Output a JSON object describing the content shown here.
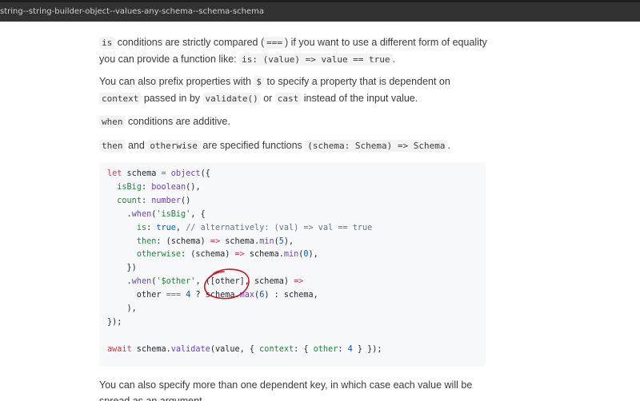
{
  "topbar": {
    "url_text": "string--string-builder-object--values-any-schema--schema-schema"
  },
  "paragraphs": {
    "p1": {
      "code1": "is",
      "text1": " conditions are strictly compared (",
      "code2": "===",
      "text2": ") if you want to use a different form of equality you can provide a function like: ",
      "code3": "is: (value) => value == true",
      "text3": "."
    },
    "p2": {
      "text1": "You can also prefix properties with ",
      "code1": "$",
      "text2": " to specify a property that is dependent on ",
      "code2": "context",
      "text3": " passed in by ",
      "code3": "validate()",
      "text4": " or ",
      "code4": "cast",
      "text5": " instead of the input value."
    },
    "p3": {
      "code1": "when",
      "text1": " conditions are additive."
    },
    "p4": {
      "code1": "then",
      "text1": " and ",
      "code2": "otherwise",
      "text2": " are specified functions ",
      "code3": "(schema: Schema) => Schema",
      "text3": "."
    },
    "p5": {
      "text1": "You can also specify more than one dependent key, in which case each value will be spread as an argument."
    }
  },
  "code": {
    "l1": [
      "let",
      " schema ",
      "=",
      " ",
      "object",
      "({"
    ],
    "l2": [
      "  ",
      "isBig",
      ": ",
      "boolean",
      "(),"
    ],
    "l3": [
      "  ",
      "count",
      ": ",
      "number",
      "()"
    ],
    "l4": [
      "    .",
      "when",
      "(",
      "'isBig'",
      ", {"
    ],
    "l5": [
      "      ",
      "is",
      ": ",
      "true",
      ", ",
      "// alternatively: (val) => val == true"
    ],
    "l6": [
      "      ",
      "then",
      ": (schema) ",
      "=>",
      " schema.",
      "min",
      "(",
      "5",
      "),"
    ],
    "l7": [
      "      ",
      "otherwise",
      ": (schema) ",
      "=>",
      " schema.",
      "min",
      "(",
      "0",
      "),"
    ],
    "l8": [
      "    })"
    ],
    "l9": [
      "    .",
      "when",
      "(",
      "'$other'",
      ", ([other], schema) ",
      "=>"
    ],
    "l10": [
      "      other ",
      "===",
      " ",
      "4",
      " ? schema.",
      "max",
      "(",
      "6",
      ") : schema,"
    ],
    "l11": [
      "    ),"
    ],
    "l12": [
      "});"
    ],
    "l13": [
      ""
    ],
    "l14": [
      "await",
      " schema.",
      "validate",
      "(value, { ",
      "context",
      ": { ",
      "other",
      ": ",
      "4",
      " } });"
    ]
  },
  "colors": {
    "annotation": "#d0161f"
  }
}
